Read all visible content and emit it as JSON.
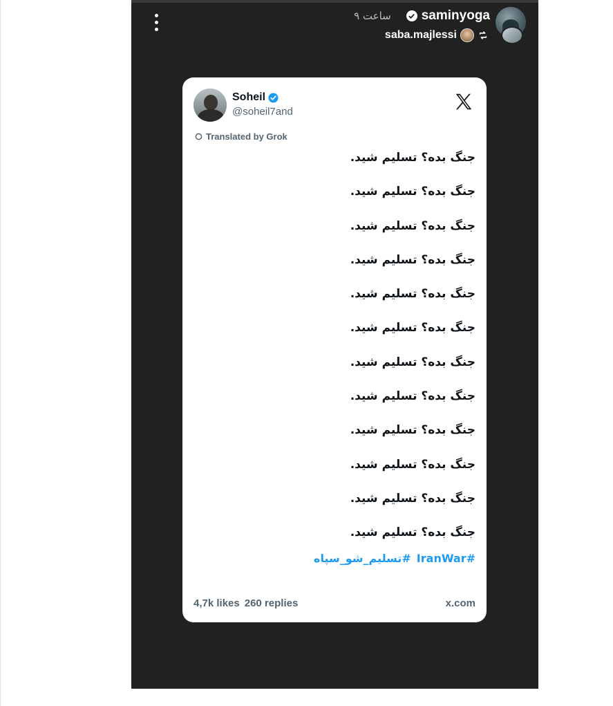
{
  "story": {
    "username": "saminyoga",
    "timestamp": "۹ ساعت",
    "reposted_by": "saba.majlessi",
    "icons": {
      "menu": "more-vertical-icon",
      "verified": "verified-badge-icon",
      "repost": "repost-icon"
    }
  },
  "tweet": {
    "author_name": "Soheil",
    "author_handle": "@soheil7and",
    "translated_label": "Translated by Grok",
    "platform_logo": "x-logo-icon",
    "lines": [
      "جنگ بده؟ تسلیم شید.",
      "جنگ بده؟ تسلیم شید.",
      "جنگ بده؟ تسلیم شید.",
      "جنگ بده؟ تسلیم شید.",
      "جنگ بده؟ تسلیم شید.",
      "جنگ بده؟ تسلیم شید.",
      "جنگ بده؟ تسلیم شید.",
      "جنگ بده؟ تسلیم شید.",
      "جنگ بده؟ تسلیم شید.",
      "جنگ بده؟ تسلیم شید.",
      "جنگ بده؟ تسلیم شید.",
      "جنگ بده؟ تسلیم شید."
    ],
    "hashtags": [
      "#IranWar",
      "#تسلیم_شو_سپاه"
    ],
    "likes": "4,7k likes",
    "replies": "260 replies",
    "source": "x.com"
  },
  "colors": {
    "story_background": "#212121",
    "card_background": "#ffffff",
    "hashtag": "#1d9bf0",
    "verified_blue": "#1d9bf0",
    "muted_text": "#536471"
  }
}
